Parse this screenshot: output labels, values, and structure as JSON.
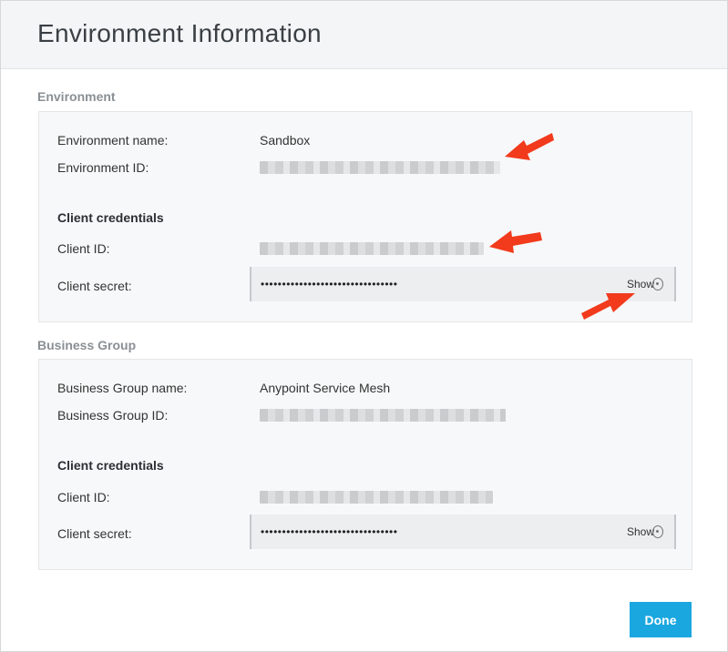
{
  "modal": {
    "title": "Environment Information",
    "done_label": "Done"
  },
  "environment": {
    "section_title": "Environment",
    "name_label": "Environment name:",
    "name_value": "Sandbox",
    "id_label": "Environment ID:",
    "credentials_heading": "Client credentials",
    "client_id_label": "Client ID:",
    "client_secret_label": "Client secret:",
    "client_secret_masked": "••••••••••••••••••••••••••••••••",
    "show_label": "Show"
  },
  "business_group": {
    "section_title": "Business Group",
    "name_label": "Business Group name:",
    "name_value": "Anypoint Service Mesh",
    "id_label": "Business Group ID:",
    "credentials_heading": "Client credentials",
    "client_id_label": "Client ID:",
    "client_secret_label": "Client secret:",
    "client_secret_masked": "••••••••••••••••••••••••••••••••",
    "show_label": "Show"
  },
  "icons": [
    "eye-icon",
    "annotation-arrow"
  ],
  "colors": {
    "primary_button": "#1aa7e0",
    "annotation_arrow": "#f23a1c",
    "panel_bg": "#f7f8f9",
    "header_bg": "#f4f5f6"
  }
}
